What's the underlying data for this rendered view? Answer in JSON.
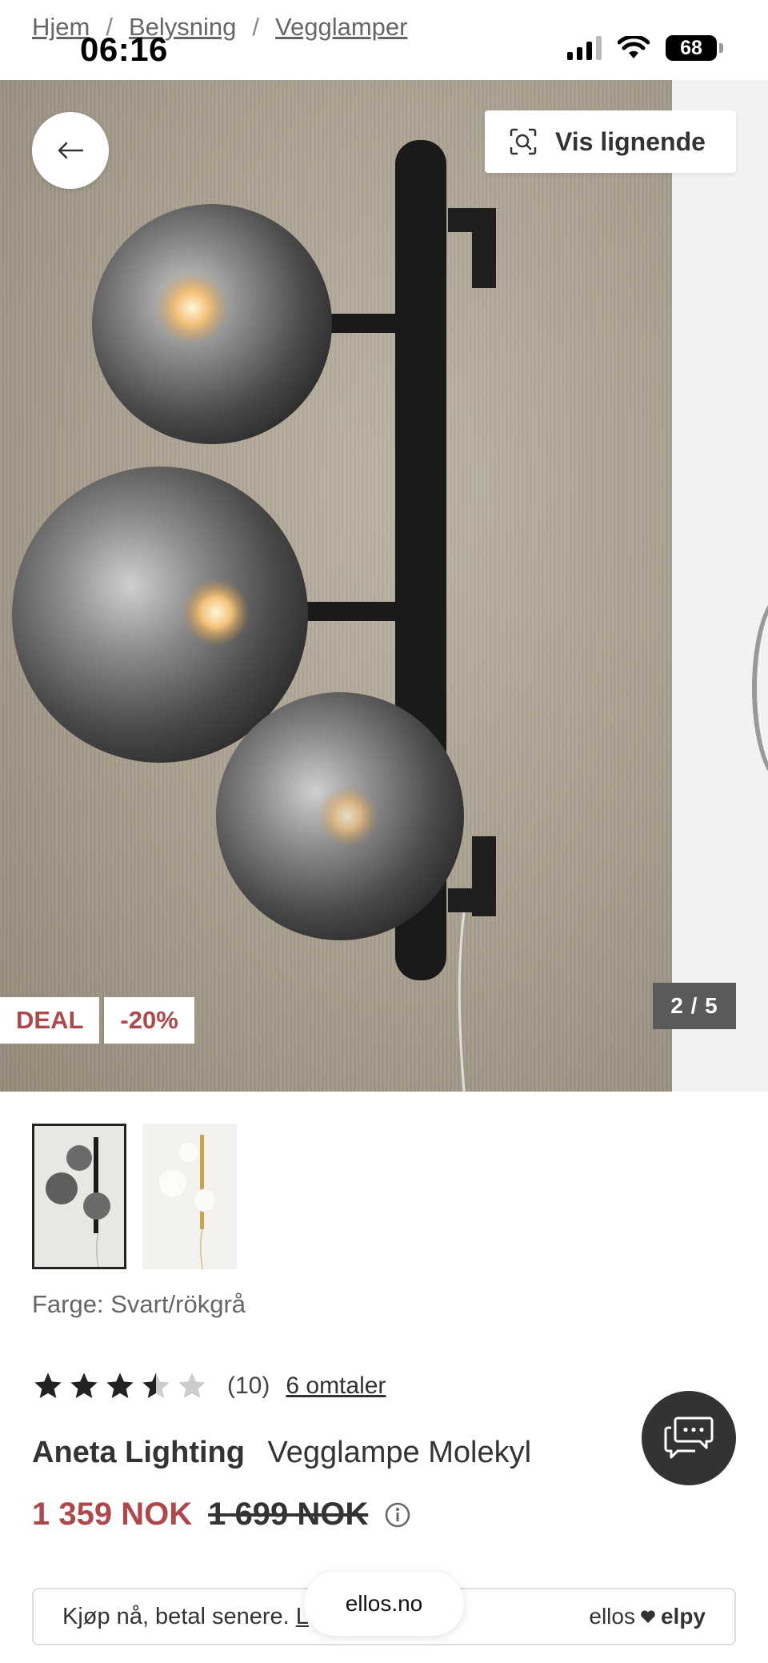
{
  "status_bar": {
    "time": "06:16",
    "battery": "68"
  },
  "breadcrumb": {
    "items": [
      "Hjem",
      "Belysning",
      "Vegglamper"
    ],
    "separator": "/"
  },
  "gallery": {
    "similar_label": "Vis lignende",
    "badges": [
      "DEAL",
      "-20%"
    ],
    "counter": "2 / 5",
    "deal_color": "#b0474b"
  },
  "product": {
    "color_line": "Farge: Svart/rökgrå",
    "rating": 3.5,
    "rating_count": "(10)",
    "reviews_link": "6 omtaler",
    "brand": "Aneta Lighting",
    "name": "Vegglampe Molekyl",
    "price_now": "1 359 NOK",
    "price_old": "1 699 NOK",
    "price_color": "#b0474b"
  },
  "bnpl": {
    "text": "Kjøp nå, betal senere. ",
    "link": "L",
    "brand_left": "ellos",
    "brand_right": "elpy"
  },
  "browser": {
    "url": "ellos.no"
  },
  "icons": [
    "arrow-left-icon",
    "visual-search-icon",
    "chat-icon",
    "info-icon",
    "star-icon",
    "heart-icon",
    "wifi-icon",
    "signal-icon",
    "battery-icon"
  ]
}
